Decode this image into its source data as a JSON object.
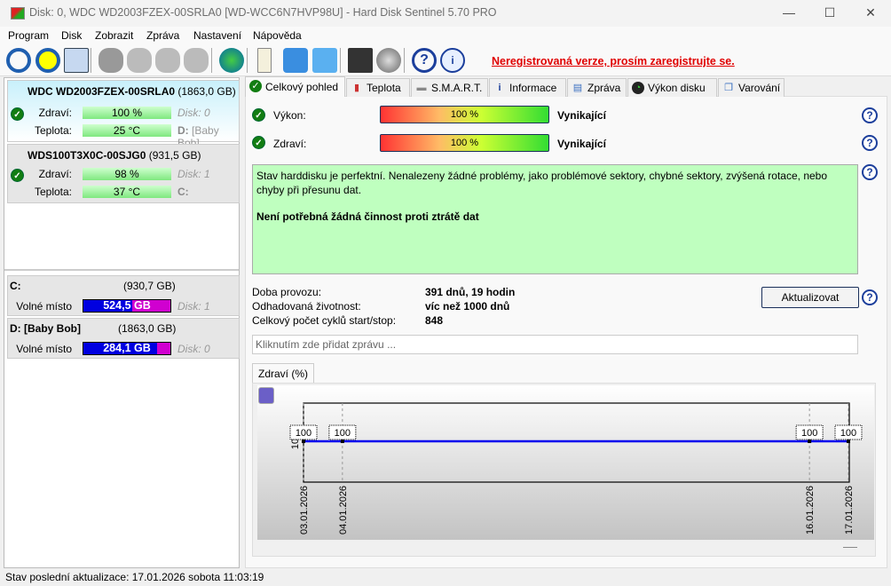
{
  "window": {
    "title": "Disk: 0, WDC WD2003FZEX-00SRLA0 [WD-WCC6N7HVP98U]  -  Hard Disk Sentinel 5.70 PRO",
    "minimize": "—",
    "maximize": "☐",
    "close": "✕"
  },
  "menu": [
    "Program",
    "Disk",
    "Zobrazit",
    "Zpráva",
    "Nastavení",
    "Nápověda"
  ],
  "toolbar": {
    "unregistered": "Neregistrovaná verze, prosím zaregistrujte se."
  },
  "disks": [
    {
      "model": "WDC WD2003FZEX-00SRLA0",
      "size": "(1863,0 GB)",
      "health_label": "Zdraví:",
      "health": "100 %",
      "temp_label": "Teplota:",
      "temp": "25 °C",
      "disk": "Disk: 0",
      "drive_letter": "D:",
      "drive_name": "[Baby Bob]"
    },
    {
      "model": "WDS100T3X0C-00SJG0",
      "size": "(931,5 GB)",
      "health_label": "Zdraví:",
      "health": "98 %",
      "temp_label": "Teplota:",
      "temp": "37 °C",
      "disk": "Disk: 1",
      "drive_letter": "C:",
      "drive_name": ""
    }
  ],
  "volumes": [
    {
      "name": "C:",
      "size": "(930,7 GB)",
      "free_label": "Volné místo",
      "free": "524,5 GB",
      "free_fraction": 0.56,
      "disk": "Disk: 1"
    },
    {
      "name": "D: [Baby Bob]",
      "size": "(1863,0 GB)",
      "free_label": "Volné místo",
      "free": "284,1 GB",
      "free_fraction": 0.85,
      "disk": "Disk: 0"
    }
  ],
  "tabs": [
    "Celkový pohled",
    "Teplota",
    "S.M.A.R.T.",
    "Informace",
    "Zpráva",
    "Výkon disku",
    "Varování"
  ],
  "overview": {
    "performance_label": "Výkon:",
    "performance": "100 %",
    "performance_verdict": "Vynikající",
    "health_label": "Zdraví:",
    "health": "100 %",
    "health_verdict": "Vynikající",
    "status_text": "Stav harddisku je perfektní. Nenalezeny žádné problémy, jako problémové sektory, chybné sektory, zvýšená rotace, nebo chyby při přesunu dat.",
    "status_action": "Není potřebná žádná činnost proti ztrátě dat",
    "uptime_label": "Doba provozu:",
    "uptime": "391 dnů, 19 hodin",
    "lifetime_label": "Odhadovaná životnost:",
    "lifetime": "víc než 1000 dnů",
    "cycles_label": "Celkový počet cyklů start/stop:",
    "cycles": "848",
    "update_button": "Aktualizovat",
    "message_placeholder": "Kliknutím zde přidat zprávu ...",
    "chart_tab": "Zdraví (%)",
    "help": "?"
  },
  "chart_data": {
    "type": "line",
    "x": [
      "03.01.2026",
      "04.01.2026",
      "16.01.2026",
      "17.01.2026"
    ],
    "x_days": [
      3,
      4,
      16,
      17
    ],
    "values": [
      100,
      100,
      100,
      100
    ],
    "labels": [
      "100",
      "100",
      "100",
      "100"
    ],
    "ytick": "100",
    "color": "#0000ee"
  },
  "statusbar": "Stav poslední aktualizace: 17.01.2026 sobota 11:03:19"
}
